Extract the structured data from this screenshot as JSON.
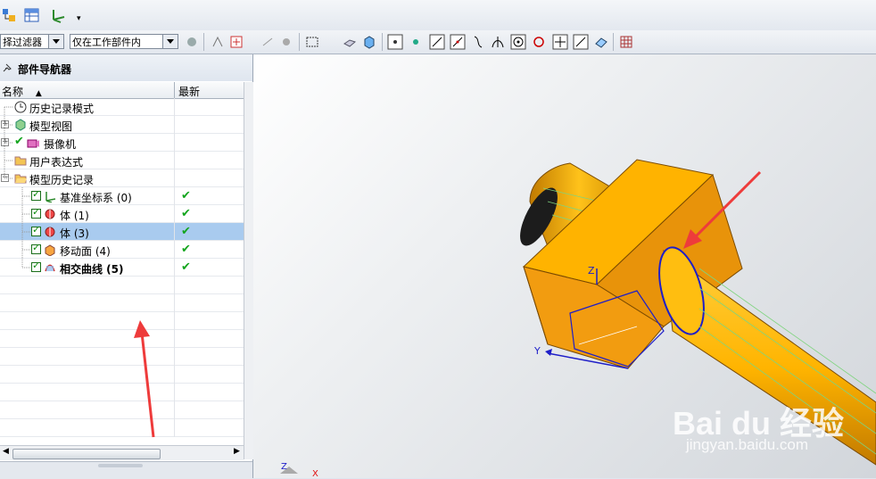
{
  "toolbar2": {
    "filter_combo": "择过滤器",
    "scope_combo": "仅在工作部件内"
  },
  "navigator": {
    "title": "部件导航器",
    "col_name": "名称",
    "col_latest": "最新",
    "rows": [
      {
        "label": "历史记录模式"
      },
      {
        "label": "模型视图"
      },
      {
        "label": "摄像机"
      },
      {
        "label": "用户表达式"
      },
      {
        "label": "模型历史记录"
      },
      {
        "label": "基准坐标系 (0)"
      },
      {
        "label": "体 (1)"
      },
      {
        "label": "体 (3)"
      },
      {
        "label": "移动面 (4)"
      },
      {
        "label": "相交曲线 (5)"
      }
    ]
  },
  "viewport": {
    "axis_z": "Z",
    "axis_y": "Y",
    "triad_z": "Z",
    "triad_x": "X"
  },
  "watermark": {
    "brand": "Bai du 经验",
    "url": "jingyan.baidu.com"
  }
}
